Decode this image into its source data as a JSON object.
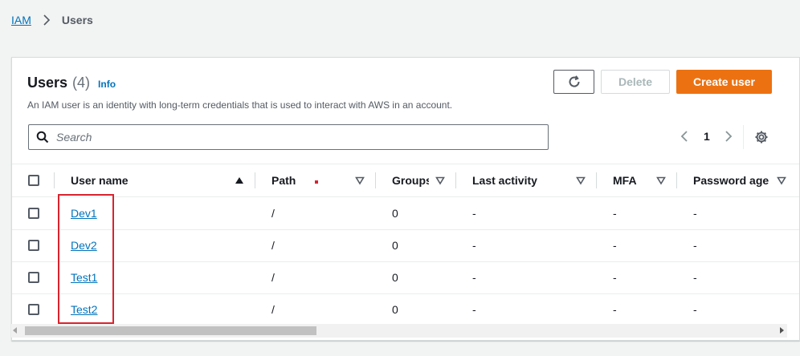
{
  "breadcrumb": {
    "root": "IAM",
    "current": "Users"
  },
  "header": {
    "title": "Users",
    "count": "(4)",
    "info": "Info",
    "description": "An IAM user is an identity with long-term credentials that is used to interact with AWS in an account."
  },
  "actions": {
    "refresh_icon": "refresh-icon",
    "delete_label": "Delete",
    "create_label": "Create user"
  },
  "search": {
    "placeholder": "Search",
    "value": ""
  },
  "pagination": {
    "page": "1"
  },
  "table": {
    "columns": [
      {
        "label": "User name",
        "sort": "ascending"
      },
      {
        "label": "Path",
        "sort": "none"
      },
      {
        "label": "Groups",
        "sort": "none"
      },
      {
        "label": "Last activity",
        "sort": "none"
      },
      {
        "label": "MFA",
        "sort": "none"
      },
      {
        "label": "Password age",
        "sort": "none"
      }
    ],
    "rows": [
      {
        "user_name": "Dev1",
        "path": "/",
        "groups": "0",
        "last_activity": "-",
        "mfa": "-",
        "password_age": "-"
      },
      {
        "user_name": "Dev2",
        "path": "/",
        "groups": "0",
        "last_activity": "-",
        "mfa": "-",
        "password_age": "-"
      },
      {
        "user_name": "Test1",
        "path": "/",
        "groups": "0",
        "last_activity": "-",
        "mfa": "-",
        "password_age": "-"
      },
      {
        "user_name": "Test2",
        "path": "/",
        "groups": "0",
        "last_activity": "-",
        "mfa": "-",
        "password_age": "-"
      }
    ]
  },
  "colors": {
    "link": "#0073bb",
    "primary_button": "#ec7211",
    "highlight": "#d9232e"
  }
}
